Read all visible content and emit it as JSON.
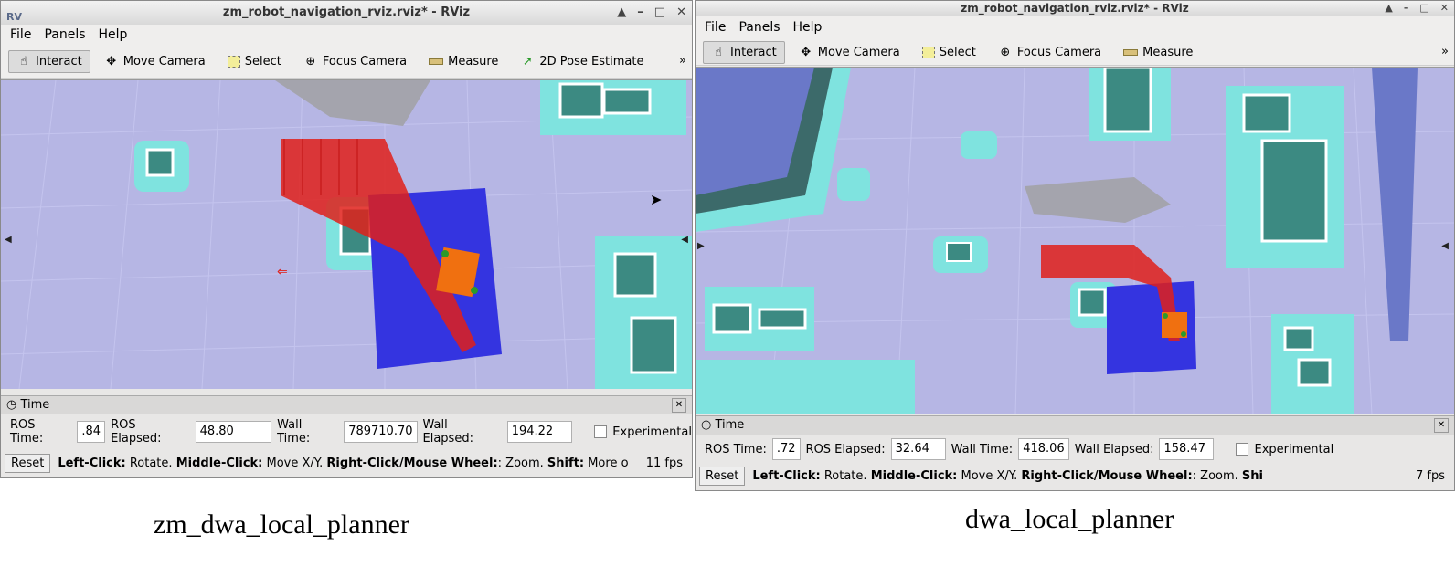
{
  "left": {
    "title": "zm_robot_navigation_rviz.rviz* - RViz",
    "logo": "RViz",
    "menu": [
      "File",
      "Panels",
      "Help"
    ],
    "tools": [
      {
        "label": "Interact",
        "icon": "hand-icon"
      },
      {
        "label": "Move Camera",
        "icon": "move-camera-icon"
      },
      {
        "label": "Select",
        "icon": "select-icon"
      },
      {
        "label": "Focus Camera",
        "icon": "focus-camera-icon"
      },
      {
        "label": "Measure",
        "icon": "ruler-icon"
      },
      {
        "label": "2D Pose Estimate",
        "icon": "pose-arrow-icon"
      }
    ],
    "time_panel_title": "Time",
    "ros_time_label": "ROS Time:",
    "ros_time_value": ".84",
    "ros_elapsed_label": "ROS Elapsed:",
    "ros_elapsed_value": "48.80",
    "wall_time_label": "Wall Time:",
    "wall_time_value": "789710.70",
    "wall_elapsed_label": "Wall Elapsed:",
    "wall_elapsed_value": "194.22",
    "experimental_label": "Experimental",
    "reset_label": "Reset",
    "hint_left": "Left-Click:",
    "hint_left_val": "Rotate.",
    "hint_middle": "Middle-Click:",
    "hint_middle_val": "Move X/Y.",
    "hint_right": "Right-Click/Mouse Wheel:",
    "hint_right_val": ": Zoom.",
    "hint_shift": "Shift:",
    "hint_shift_val": "More o",
    "fps": "11 fps",
    "caption": "zm_dwa_local_planner"
  },
  "right": {
    "title": "zm_robot_navigation_rviz.rviz* - RViz",
    "menu": [
      "File",
      "Panels",
      "Help"
    ],
    "tools": [
      {
        "label": "Interact",
        "icon": "hand-icon"
      },
      {
        "label": "Move Camera",
        "icon": "move-camera-icon"
      },
      {
        "label": "Select",
        "icon": "select-icon"
      },
      {
        "label": "Focus Camera",
        "icon": "focus-camera-icon"
      },
      {
        "label": "Measure",
        "icon": "ruler-icon"
      }
    ],
    "time_panel_title": "Time",
    "ros_time_label": "ROS Time:",
    "ros_time_value": ".72",
    "ros_elapsed_label": "ROS Elapsed:",
    "ros_elapsed_value": "32.64",
    "wall_time_label": "Wall Time:",
    "wall_time_value": "418.06",
    "wall_elapsed_label": "Wall Elapsed:",
    "wall_elapsed_value": "158.47",
    "experimental_label": "Experimental",
    "reset_label": "Reset",
    "hint_left": "Left-Click:",
    "hint_left_val": "Rotate.",
    "hint_middle": "Middle-Click:",
    "hint_middle_val": "Move X/Y.",
    "hint_right": "Right-Click/Mouse Wheel:",
    "hint_right_val": ": Zoom.",
    "hint_shift": "Shi",
    "fps": "7 fps",
    "caption": "dwa_local_planner"
  },
  "colors": {
    "map_free": "#b6b6e4",
    "costmap_cyan": "#7fe3df",
    "obstacle": "#3c8a82",
    "local_costmap": "#3434e0",
    "trajectory": "#e0201a",
    "robot": "#f07010"
  }
}
